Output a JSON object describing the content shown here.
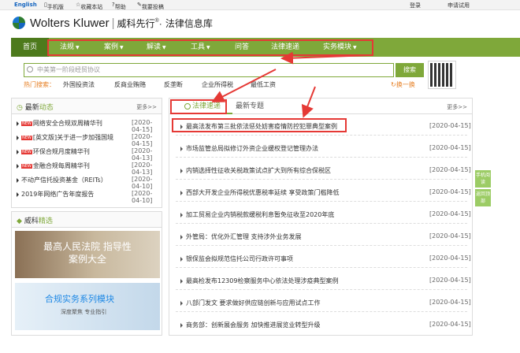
{
  "topbar": {
    "english": "English",
    "mobile": "手机版",
    "favorite": "收藏本站",
    "help": "帮助",
    "feedback": "我要投稿",
    "login": "登录",
    "trial": "申请试用"
  },
  "header": {
    "brand": "Wolters Kluwer",
    "brand_cn": "威科先行",
    "reg": "®",
    "dot": "·",
    "subtitle": "法律信息库"
  },
  "nav": {
    "home": "首页",
    "items": [
      "法规",
      "案例",
      "解读",
      "工具",
      "问答",
      "法律速递",
      "实务模块"
    ]
  },
  "search": {
    "placeholder": "中美第一阶段经贸协议",
    "button": "搜索",
    "hot_label": "热门搜索：",
    "hot_keywords": [
      "外国投资法",
      "反商业贿赂",
      "反垄断",
      "企业所得税",
      "最低工资"
    ],
    "refresh": "换一换"
  },
  "latest": {
    "title_prefix": "最新",
    "title_highlight": "动态",
    "more": "更多>>",
    "new_badge": "NEW",
    "items": [
      {
        "text": "网络安全合规双周精华刊",
        "date": "[2020-04-15]",
        "new": true
      },
      {
        "text": "[英文版]关于进一步加强国境",
        "date": "[2020-04-15]",
        "new": true
      },
      {
        "text": "环保合规月度精华刊",
        "date": "[2020-04-13]",
        "new": true
      },
      {
        "text": "金融合规每周精华刊",
        "date": "[2020-04-13]",
        "new": true
      },
      {
        "text": "不动产信托投资基金（REITs）",
        "date": "[2020-04-10]",
        "new": false
      },
      {
        "text": "2019年网络广告年度报告",
        "date": "[2020-04-10]",
        "new": false
      }
    ]
  },
  "jingxuan": {
    "title_prefix": "威科",
    "title_highlight": "精选",
    "banner1": "最高人民法院 指导性案例大全",
    "banner2_title": "合规实务系列模块",
    "banner2_sub": "深度聚焦 专业指引"
  },
  "express": {
    "tab_active": "法律速递",
    "tab_other": "最新专题",
    "more": "更多>>",
    "items": [
      {
        "text": "最高法发布第三批依法惩处妨害疫情防控犯罪典型案例",
        "date": "[2020-04-15]"
      },
      {
        "text": "市场监管总局拟修订外资企业缓权登记管理办法",
        "date": "[2020-04-15]"
      },
      {
        "text": "内销选择性征收关税政策试点扩大到所有综合保税区",
        "date": "[2020-04-15]"
      },
      {
        "text": "西部大开发企业所得税优惠税率延续 享受政策门槛降低",
        "date": "[2020-04-15]"
      },
      {
        "text": "加工贸易企业内销税款缓税利息暂免征收至2020年底",
        "date": "[2020-04-15]"
      },
      {
        "text": "外管局：优化外汇管理 支持涉外业务发展",
        "date": "[2020-04-15]"
      },
      {
        "text": "银保监会拟规范信托公司行政许可事项",
        "date": "[2020-04-15]"
      },
      {
        "text": "最高检发布12309检察服务中心依法处理涉疫典型案例",
        "date": "[2020-04-15]"
      },
      {
        "text": "八部门发文 要求做好供应链创新与应用试点工作",
        "date": "[2020-04-15]"
      },
      {
        "text": "商务部：创新展会服务 加快推进展览业转型升级",
        "date": "[2020-04-15]"
      }
    ]
  },
  "side": {
    "mobile_read": "手机阅读",
    "back_top": "返回顶部"
  },
  "colors": {
    "accent_green": "#7fa83a",
    "dark_green": "#4d7a1c",
    "annotation_red": "#e53935",
    "hot_orange": "#e67e22"
  }
}
